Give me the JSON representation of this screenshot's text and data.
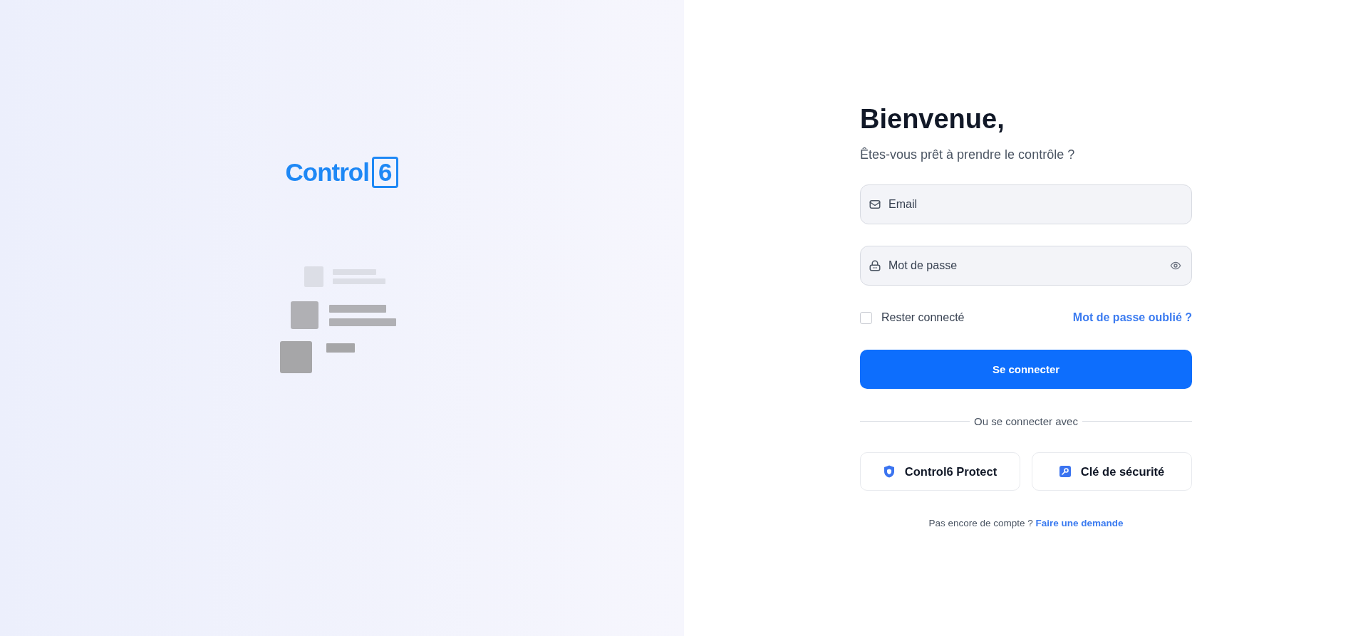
{
  "brand": {
    "name": "Control",
    "badge": "6"
  },
  "login": {
    "title": "Bienvenue,",
    "subtitle": "Êtes-vous prêt à prendre le contrôle ?",
    "fields": [
      {
        "kind": "email",
        "placeholder": "Email"
      },
      {
        "kind": "password",
        "placeholder": "Mot de passe"
      }
    ],
    "remember": {
      "label": "Rester connecté",
      "checked": false
    },
    "forgot_link": "Mot de passe oublié ?",
    "submit": "Se connecter",
    "divider": "Ou se connecter avec",
    "alternatives": [
      {
        "kind": "shield",
        "label": "Control6 Protect"
      },
      {
        "kind": "key",
        "label": "Clé de sécurité"
      }
    ],
    "signup": {
      "text": "Pas encore de compte ?",
      "link": "Faire une demande"
    }
  }
}
